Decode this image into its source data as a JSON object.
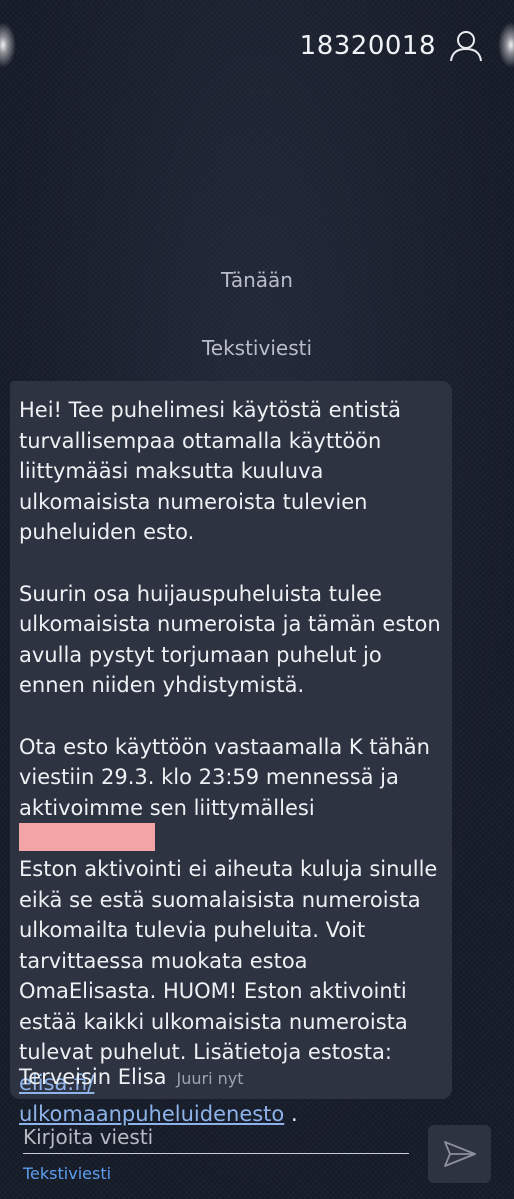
{
  "header": {
    "contact_number": "18320018",
    "contact_icon": "person-icon"
  },
  "conversation": {
    "date_label": "Tänään",
    "message_type_label": "Tekstiviesti"
  },
  "message": {
    "paragraph1": "Hei! Tee puhelimesi käytöstä entistä turvallisempaa ottamalla käyttöön liittymääsi maksutta kuuluva ulkomaisista numeroista tulevien puheluiden esto.",
    "paragraph2": "Suurin osa huijauspuheluista tulee ulkomaisista numeroista ja tämän eston avulla pystyt torjumaan puhelut jo ennen niiden yhdistymistä.",
    "paragraph3_before_redaction": "Ota esto käyttöön vastaamalla K tähän viestiin 29.3. klo 23:59 mennessä ja aktivoimme sen liittymällesi",
    "paragraph3_after_redaction": "Eston aktivointi ei aiheuta kuluja sinulle eikä se estä suomalaisista numeroista ulkomailta tulevia puheluita. Voit tarvittaessa muokata estoa OmaElisasta. HUOM! Eston aktivointi estää kaikki ulkomaisista numeroista tulevat puhelut. Lisätietoja estosta:",
    "link_line1": "elisa.fi/",
    "link_line2": "ulkomaanpuheluidenesto",
    "after_link": " .",
    "signature": "Terveisin Elisa",
    "timestamp": "Juuri nyt",
    "redaction_color": "#f2a4a7"
  },
  "compose": {
    "placeholder": "Kirjoita viesti",
    "mode_label": "Tekstiviesti",
    "send_icon": "send-icon"
  },
  "colors": {
    "background": "#161b28",
    "bubble": "#2e3341",
    "link": "#8db3ea",
    "accent": "#5d9ef0"
  }
}
